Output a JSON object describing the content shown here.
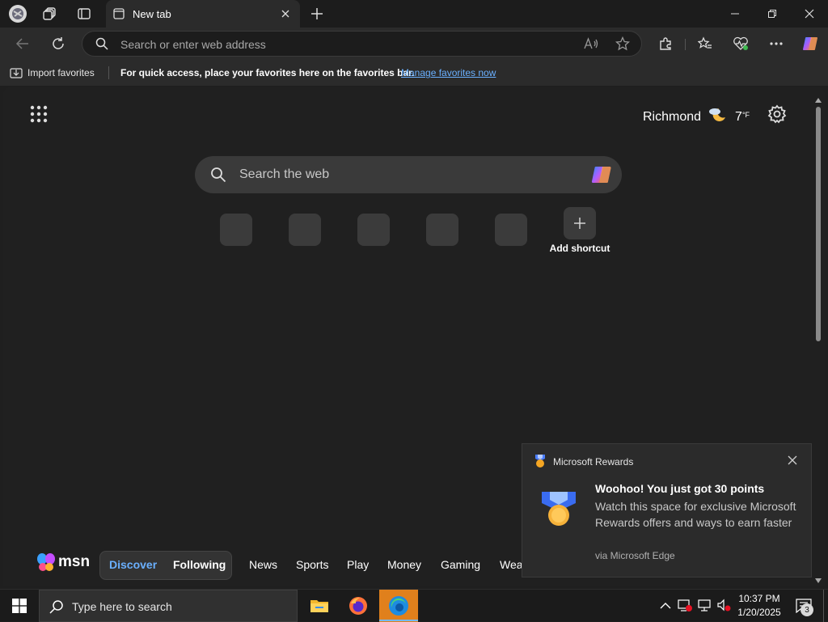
{
  "browser": {
    "tab_title": "New tab",
    "address_placeholder": "Search or enter web address"
  },
  "favorites_bar": {
    "import_label": "Import favorites",
    "message": "For quick access, place your favorites here on the favorites bar.",
    "manage_link": "Manage favorites now"
  },
  "newtab": {
    "weather_city": "Richmond",
    "weather_temp": "7",
    "weather_unit": "°F",
    "search_placeholder": "Search the web",
    "add_shortcut_label": "Add shortcut"
  },
  "msn": {
    "brand": "msn",
    "tabs": [
      "Discover",
      "Following"
    ],
    "active_tab": "Discover",
    "categories": [
      "News",
      "Sports",
      "Play",
      "Money",
      "Gaming",
      "Wea"
    ]
  },
  "toast": {
    "app_name": "Microsoft Rewards",
    "title": "Woohoo! You just got 30 points",
    "body": "Watch this space for exclusive Microsoft Rewards offers and ways to earn faster",
    "via": "via Microsoft Edge"
  },
  "taskbar": {
    "search_placeholder": "Type here to search",
    "time": "10:37 PM",
    "date": "1/20/2025",
    "notification_count": "3"
  },
  "colors": {
    "accent_link": "#6ab0ff",
    "active_tab_text": "#6ab0ff"
  }
}
